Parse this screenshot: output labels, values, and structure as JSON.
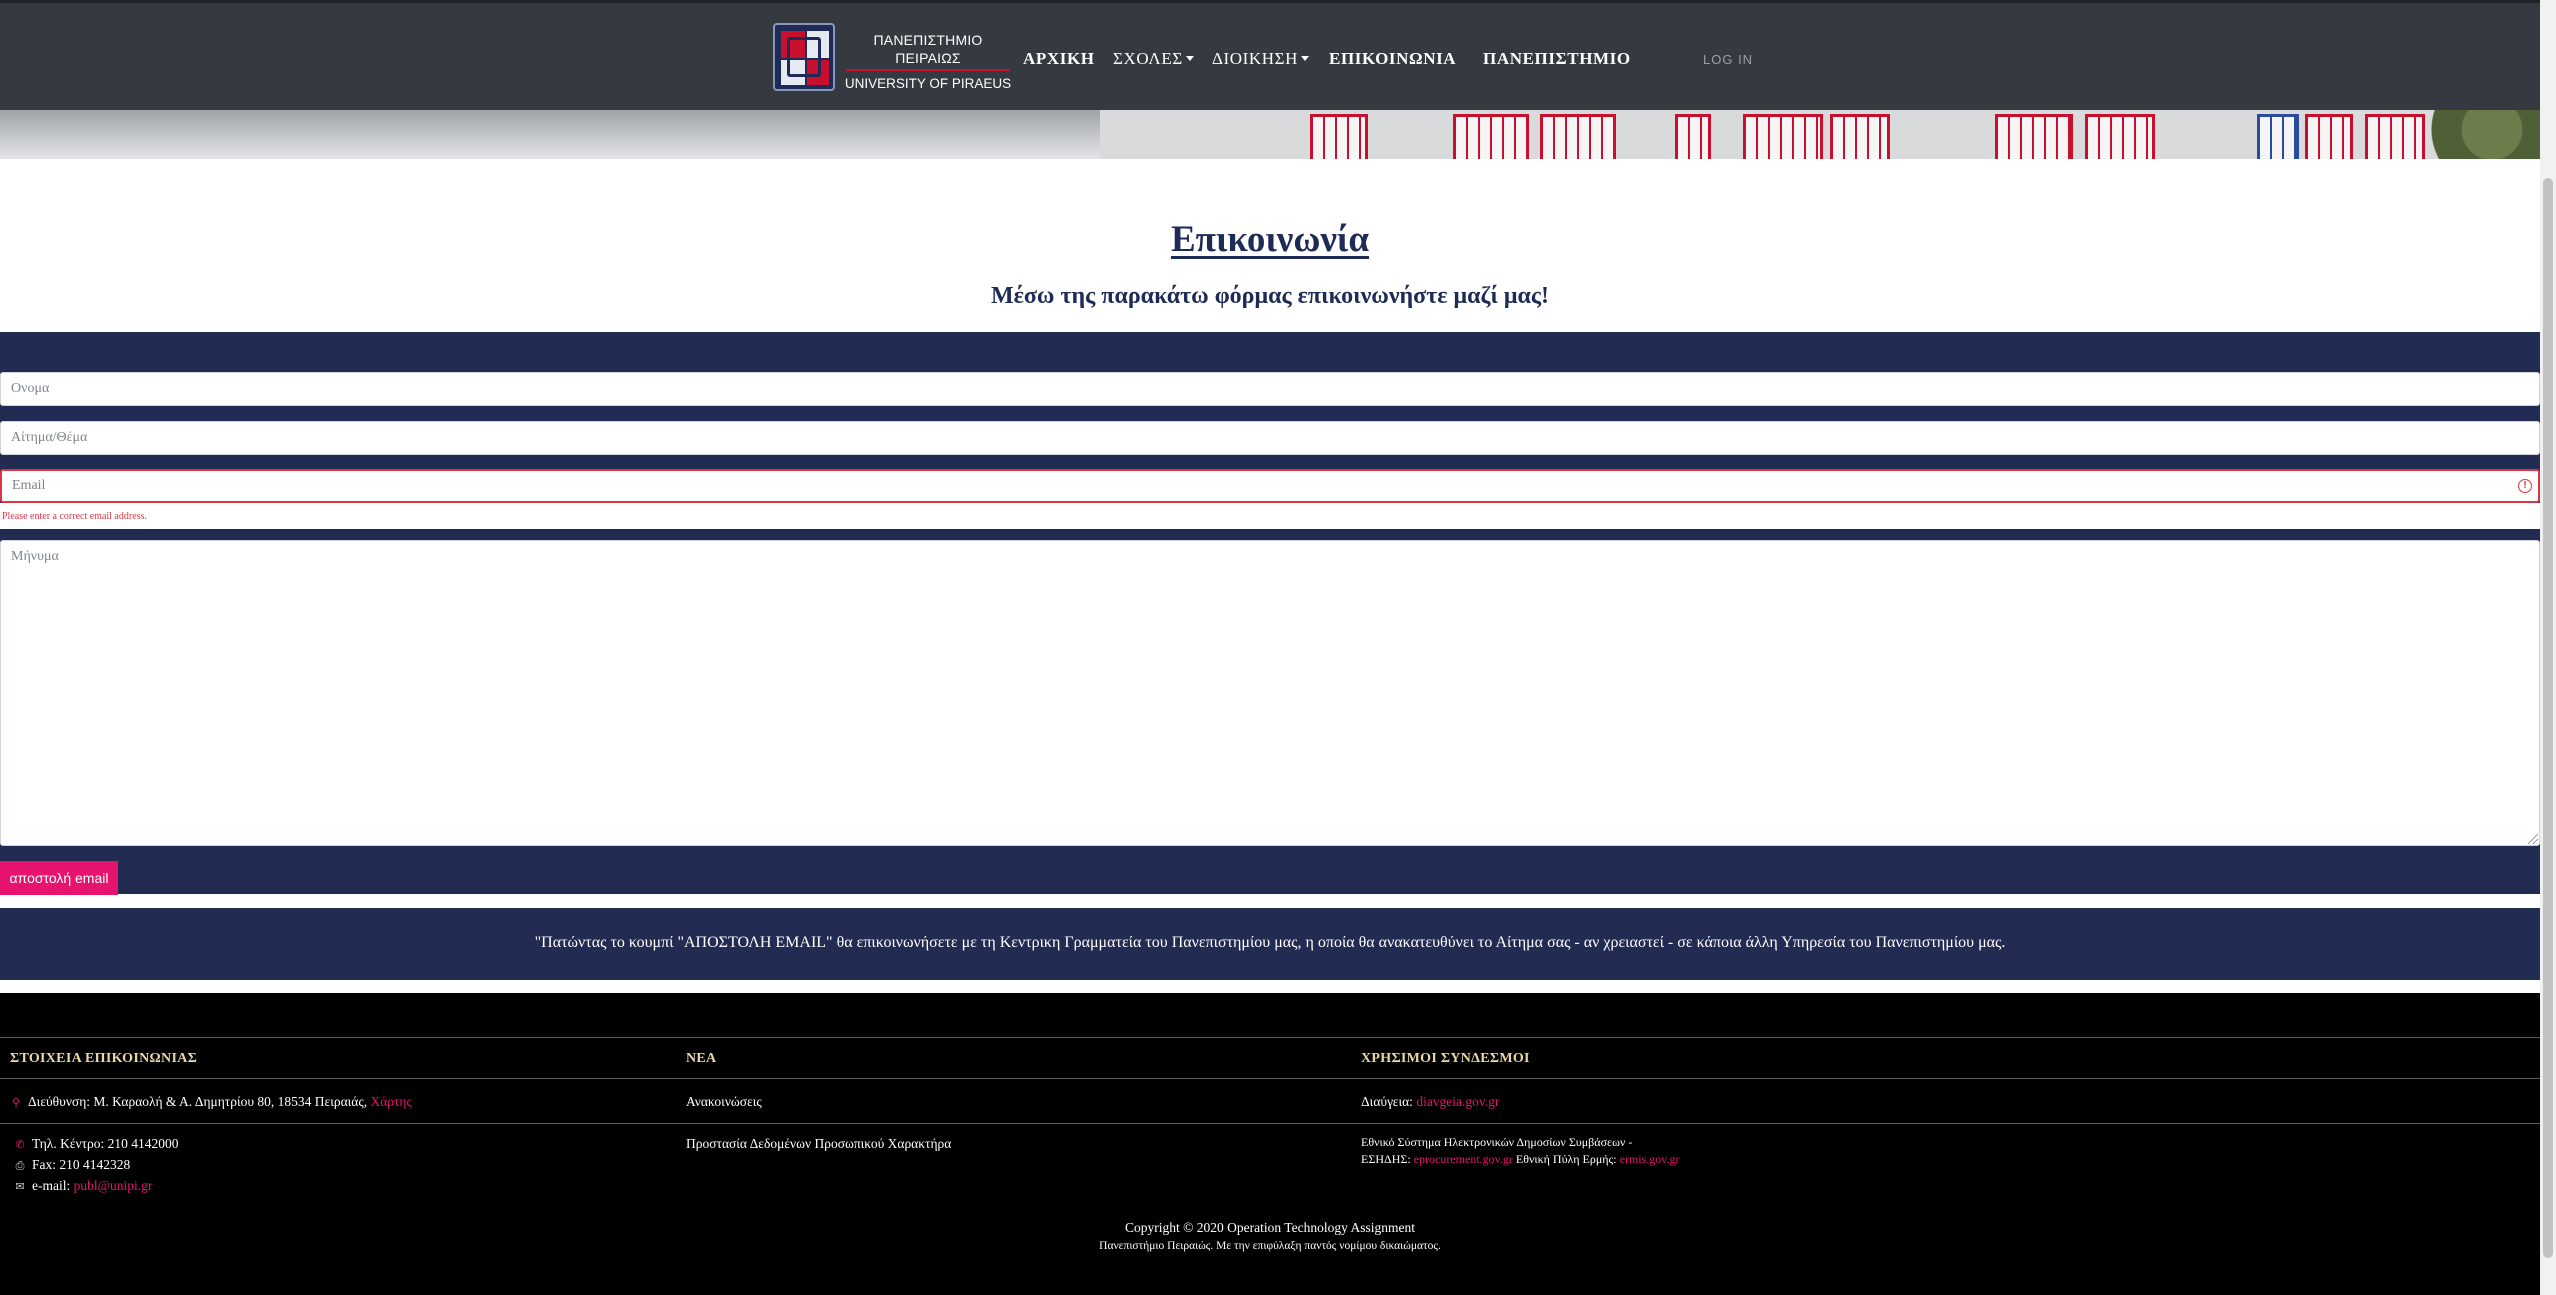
{
  "navbar": {
    "brand_line1": "ΠΑΝΕΠΙΣΤΗΜΙΟ ΠΕΙΡΑΙΩΣ",
    "brand_line2": "UNIVERSITY OF PIRAEUS",
    "items": [
      {
        "label": "ΑΡΧΙΚΗ"
      },
      {
        "label": "ΣΧΟΛΕΣ"
      },
      {
        "label": "ΔΙΟΙΚΗΣΗ"
      },
      {
        "label": "ΕΠΙΚΟΙΝΩΝΙΑ"
      },
      {
        "label": "ΠΑΝΕΠΙΣΤΗΜΙΟ"
      }
    ],
    "login": "LOG IN"
  },
  "page": {
    "title": "Επικοινωνία",
    "subtitle": "Μέσω της παρακάτω φόρμας επικοινωνήστε μαζί μας!"
  },
  "form": {
    "name_placeholder": "Ονομα",
    "subject_placeholder": "Αίτημα/Θέμα",
    "email_placeholder": "Email",
    "email_error": "Please enter a correct email address.",
    "message_placeholder": "Μήνυμα",
    "send_label": "αποστολή email"
  },
  "note": "\"Πατώντας το κουμπί  \"ΑΠΟΣΤΟΛΗ EMAIL\"  θα επικοινωνήσετε με τη Κεντρικη Γραμματεία του Πανεπιστημίου μας, η οποία θα ανακατευθύνει το Αίτημα σας - αν χρειαστεί - σε κάποια άλλη Υπηρεσία του Πανεπιστημίου μας.",
  "footer": {
    "contact": {
      "heading": "ΣΤΟΙΧΕΙΑ ΕΠΙΚΟΙΝΩΝΙΑΣ",
      "address": "Διεύθυνση: Μ. Καραολή & Α. Δημητρίου 80, 18534 Πειραιάς,",
      "map_link": "Χάρτης",
      "phone": "Τηλ. Κέντρο: 210 4142000",
      "fax": "Fax: 210 4142328",
      "email_label": "e-mail:",
      "email_link": "publ@unipi.gr"
    },
    "news": {
      "heading": "ΝΕΑ",
      "item1": "Ανακοινώσεις",
      "item2": "Προστασία Δεδομένων Προσωπικού Χαρακτήρα"
    },
    "links": {
      "heading": "ΧΡΗΣΙΜΟΙ ΣΥΝΔΕΣΜΟΙ",
      "diavgeia_label": "Διαύγεια:",
      "diavgeia_link": "diavgeia.gov.gr",
      "eshidis_line1": "Εθνικό Σύστημα Ηλεκτρονικών Δημοσίων Συμβάσεων -",
      "eshidis_label": "ΕΣΗΔΗΣ:",
      "eprocurement_link": "eprocurement.gov.gr",
      "ermis_label": "Εθνική Πύλη Ερμής:",
      "ermis_link": "ermis.gov.gr"
    },
    "copyright": "Copyright ©  2020  Operation Technology Assignment",
    "rights": "Πανεπιστήμιο Πειραιώς. Με την επιφύλαξη παντός νομίμου δικαιώματος."
  },
  "colors": {
    "navbar": "#343a40",
    "navy": "#222b52",
    "accent_pink": "#e6136f",
    "error_red": "#dc3545",
    "footer_heading": "#e8d9a8"
  },
  "icons": {
    "address": "map-marker-icon",
    "phone": "phone-icon",
    "fax": "fax-icon",
    "email": "envelope-icon"
  }
}
